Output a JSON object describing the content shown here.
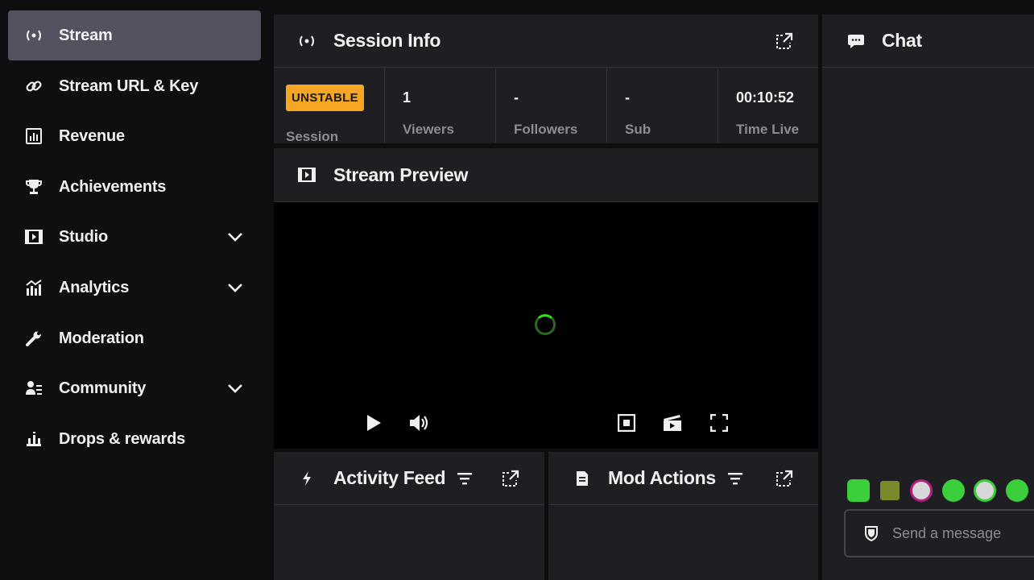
{
  "sidebar": {
    "items": [
      {
        "label": "Stream",
        "icon": "broadcast-icon",
        "active": true,
        "expandable": false
      },
      {
        "label": "Stream URL & Key",
        "icon": "link-icon",
        "active": false,
        "expandable": false
      },
      {
        "label": "Revenue",
        "icon": "revenue-chart-icon",
        "active": false,
        "expandable": false
      },
      {
        "label": "Achievements",
        "icon": "trophy-icon",
        "active": false,
        "expandable": false
      },
      {
        "label": "Studio",
        "icon": "studio-icon",
        "active": false,
        "expandable": true
      },
      {
        "label": "Analytics",
        "icon": "analytics-icon",
        "active": false,
        "expandable": true
      },
      {
        "label": "Moderation",
        "icon": "wrench-icon",
        "active": false,
        "expandable": false
      },
      {
        "label": "Community",
        "icon": "community-icon",
        "active": false,
        "expandable": true
      },
      {
        "label": "Drops & rewards",
        "icon": "drops-icon",
        "active": false,
        "expandable": false
      }
    ]
  },
  "session_info": {
    "title": "Session Info",
    "badge": "UNSTABLE",
    "session_label": "Session",
    "stats": [
      {
        "value": "1",
        "label": "Viewers"
      },
      {
        "value": "-",
        "label": "Followers"
      },
      {
        "value": "-",
        "label": "Sub"
      },
      {
        "value": "00:10:52",
        "label": "Time Live"
      }
    ]
  },
  "stream_preview": {
    "title": "Stream Preview"
  },
  "activity_feed": {
    "title": "Activity Feed"
  },
  "mod_actions": {
    "title": "Mod Actions"
  },
  "chat": {
    "title": "Chat",
    "input_placeholder": "Send a message"
  },
  "colors": {
    "accent_badge": "#f5a623",
    "spinner": "#3ddc25",
    "panel_bg": "#1f1f23",
    "app_bg": "#0e0e10",
    "active_nav": "#53535f"
  }
}
